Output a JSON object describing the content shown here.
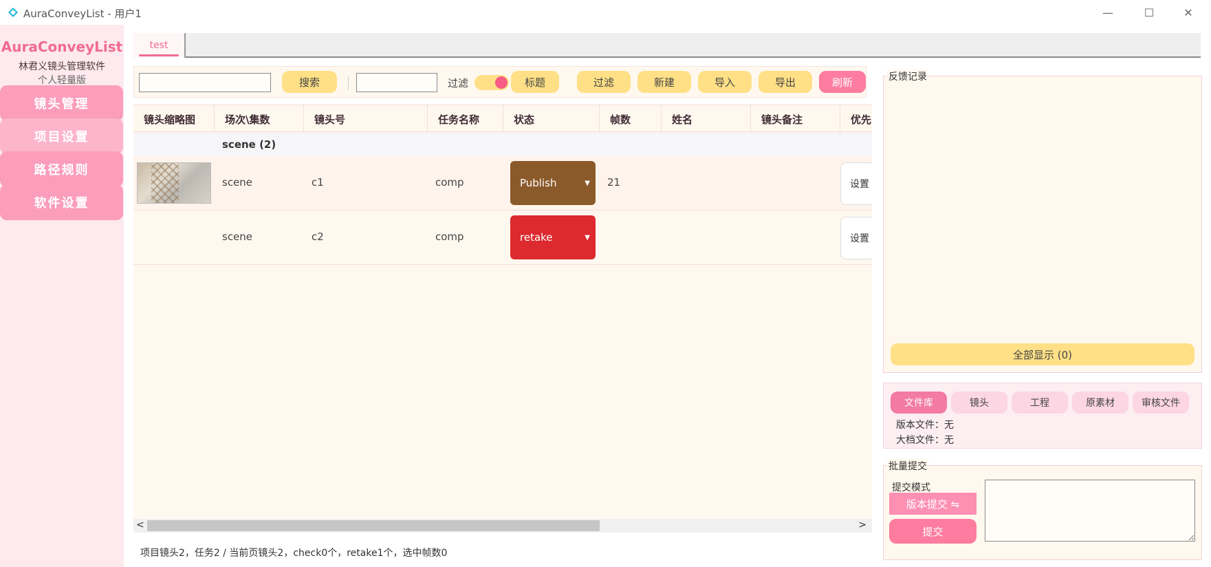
{
  "window": {
    "title": "AuraConveyList - 用户1",
    "min_glyph": "—",
    "max_glyph": "☐",
    "close_glyph": "✕"
  },
  "brand": {
    "title": "AuraConveyList",
    "subtitle": "林君义镜头管理软件",
    "edition": "个人轻量版"
  },
  "nav": [
    {
      "label": "镜头管理"
    },
    {
      "label": "项目设置"
    },
    {
      "label": "路径规则"
    },
    {
      "label": "软件设置"
    }
  ],
  "tabs": [
    {
      "label": "test"
    }
  ],
  "toolbar": {
    "search_value": "",
    "search_label": "搜索",
    "filter_value": "",
    "filter_label": "过滤",
    "filter_toggle_on": true,
    "title_label": "标题",
    "filter_btn_label": "过滤",
    "new_label": "新建",
    "import_label": "导入",
    "export_label": "导出",
    "refresh_label": "刷新"
  },
  "table": {
    "columns": [
      "镜头缩略图",
      "场次\\集数",
      "镜头号",
      "任务名称",
      "状态",
      "帧数",
      "姓名",
      "镜头备注",
      "优先"
    ],
    "group_label": "scene (2)",
    "rows": [
      {
        "scene": "scene",
        "shot": "c1",
        "task": "comp",
        "status": "Publish",
        "status_color": "#8b5a2b",
        "frames": "21",
        "name": "",
        "note": "",
        "action": "设置"
      },
      {
        "scene": "scene",
        "shot": "c2",
        "task": "comp",
        "status": "retake",
        "status_color": "#dc2a2f",
        "frames": "",
        "name": "",
        "note": "",
        "action": "设置"
      }
    ]
  },
  "scrollbar": {
    "left_glyph": "<",
    "right_glyph": ">"
  },
  "status_text": "项目镜头2，任务2 / 当前页镜头2，check0个，retake1个，选中帧数0",
  "feedback": {
    "title": "反馈记录",
    "show_all_label": "全部显示 (0)"
  },
  "files": {
    "tabs": [
      {
        "label": "文件库",
        "active": true
      },
      {
        "label": "镜头",
        "active": false
      },
      {
        "label": "工程",
        "active": false
      },
      {
        "label": "原素材",
        "active": false
      },
      {
        "label": "审核文件",
        "active": false
      }
    ],
    "version_file": "版本文件：无",
    "archive_file": "大档文件：无"
  },
  "batch": {
    "title": "批量提交",
    "mode_label": "提交模式",
    "mode_value": "版本提交 ⇋",
    "submit_label": "提交",
    "text_value": ""
  },
  "colors": {
    "accent_pink": "#fd7ca0",
    "accent_yellow": "#ffe086",
    "sidebar_bg": "#fde9ee",
    "publish": "#8b5a2b",
    "retake": "#dc2a2f"
  }
}
